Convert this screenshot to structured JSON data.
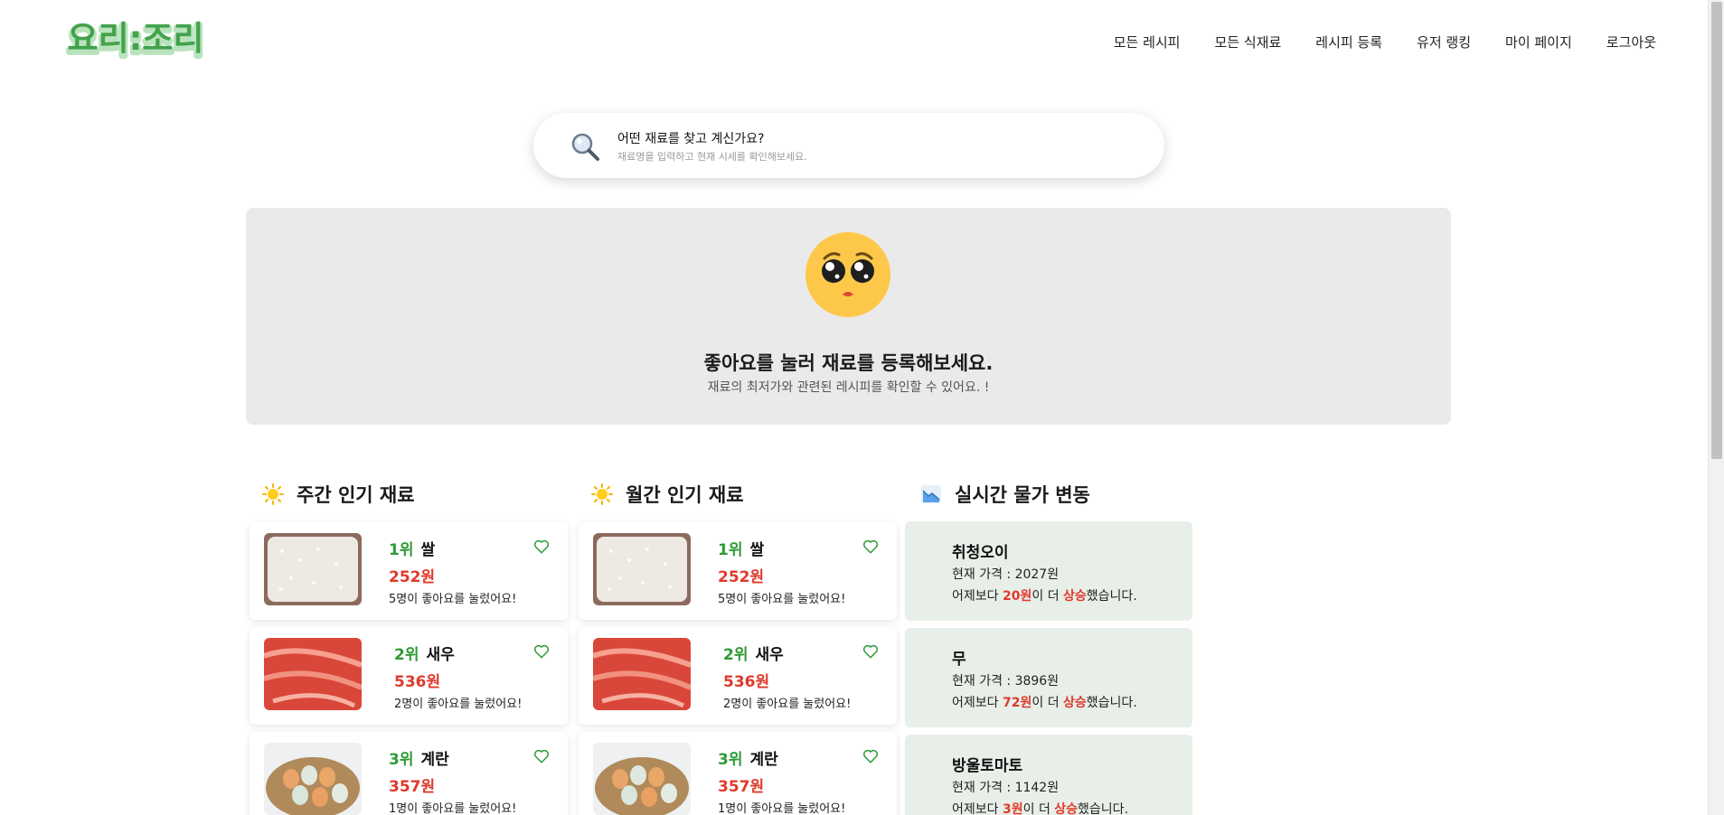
{
  "header": {
    "logo_text": "요리:조리",
    "nav": [
      "모든 레시피",
      "모든 식재료",
      "레시피 등록",
      "유저 랭킹",
      "마이 페이지",
      "로그아웃"
    ]
  },
  "search": {
    "title": "어떤 재료를 찾고 계신가요?",
    "placeholder": "재료명을 입력하고 현재 시세를 확인해보세요."
  },
  "banner": {
    "title": "좋아요를 눌러 재료를 등록해보세요.",
    "subtitle": "재료의 최저가와 관련된 레시피를 확인할 수 있어요. !"
  },
  "weekly": {
    "title": "주간 인기 재료",
    "items": [
      {
        "rank": "1위",
        "name": "쌀",
        "price": "252원",
        "likes": "5명이 좋아요를 눌렀어요!"
      },
      {
        "rank": "2위",
        "name": "새우",
        "price": "536원",
        "likes": "2명이 좋아요를 눌렀어요!"
      },
      {
        "rank": "3위",
        "name": "계란",
        "price": "357원",
        "likes": "1명이 좋아요를 눌렀어요!"
      }
    ]
  },
  "monthly": {
    "title": "월간 인기 재료",
    "items": [
      {
        "rank": "1위",
        "name": "쌀",
        "price": "252원",
        "likes": "5명이 좋아요를 눌렀어요!"
      },
      {
        "rank": "2위",
        "name": "새우",
        "price": "536원",
        "likes": "2명이 좋아요를 눌렀어요!"
      },
      {
        "rank": "3위",
        "name": "계란",
        "price": "357원",
        "likes": "1명이 좋아요를 눌렀어요!"
      }
    ]
  },
  "realtime": {
    "title": "실시간 물가 변동",
    "items": [
      {
        "name": "취청오이",
        "current": "현재 가격 : 2027원",
        "pre": "어제보다 ",
        "amount": "20원",
        "mid": "이 더 ",
        "dir": "상승",
        "post": "했습니다."
      },
      {
        "name": "무",
        "current": "현재 가격 : 3896원",
        "pre": "어제보다 ",
        "amount": "72원",
        "mid": "이 더 ",
        "dir": "상승",
        "post": "했습니다."
      },
      {
        "name": "방울토마토",
        "current": "현재 가격 : 1142원",
        "pre": "어제보다 ",
        "amount": "3원",
        "mid": "이 더 ",
        "dir": "상승",
        "post": "했습니다."
      }
    ]
  },
  "colors": {
    "brand_green": "#43a24c",
    "rank_green": "#2e9a36",
    "price_red": "#e0392b",
    "banner_bg": "#eaeaea",
    "price_card_bg": "#e8efe9"
  }
}
